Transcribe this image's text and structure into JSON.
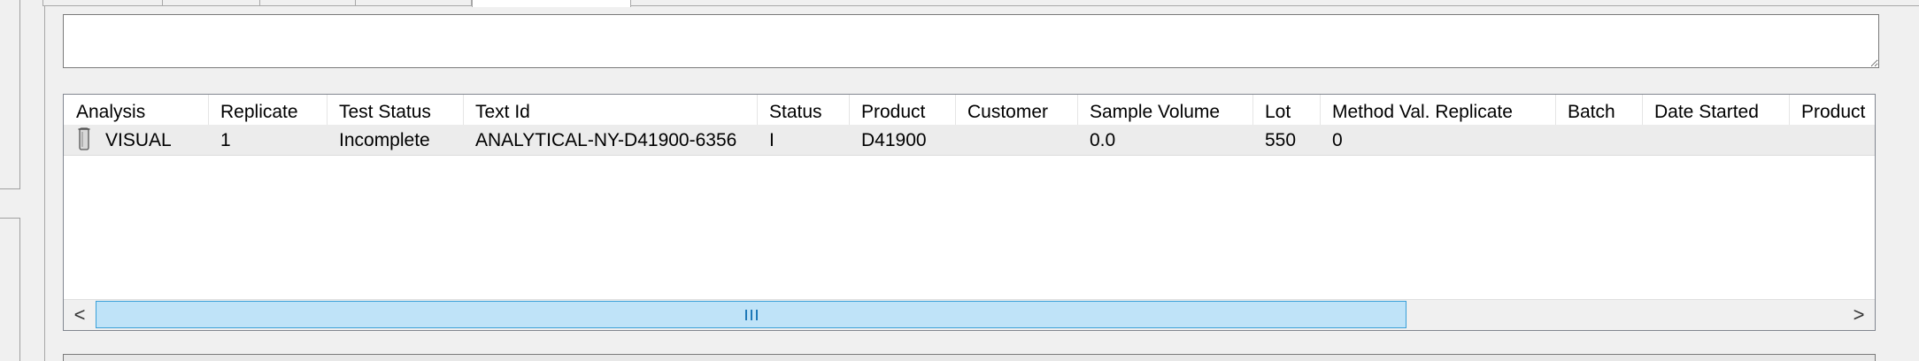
{
  "window": {
    "comment_box_value": ""
  },
  "grid": {
    "columns": [
      "Analysis",
      "Replicate",
      "Test Status",
      "Text Id",
      "Status",
      "Product",
      "Customer",
      "Sample Volume",
      "Lot",
      "Method Val. Replicate",
      "Batch",
      "Date Started",
      "Product"
    ],
    "rows": [
      {
        "analysis": "VISUAL",
        "replicate": "1",
        "test_status": "Incomplete",
        "text_id": "ANALYTICAL-NY-D41900-6356",
        "status": "I",
        "product": "D41900",
        "customer": "",
        "sample_volume": "0.0",
        "lot": "550",
        "method_val_replicate": "0",
        "batch": "",
        "date_started": "",
        "product_2": ""
      }
    ],
    "row_icon": "test-tube-icon"
  },
  "scrollbar": {
    "left_arrow": "<",
    "right_arrow": ">",
    "thumb_grip_icon": "grip-icon",
    "visible_fraction": 0.75
  },
  "colors": {
    "thumb_fill": "#bfe3f8",
    "thumb_border": "#3aa0d8",
    "row_background": "#ececec"
  }
}
